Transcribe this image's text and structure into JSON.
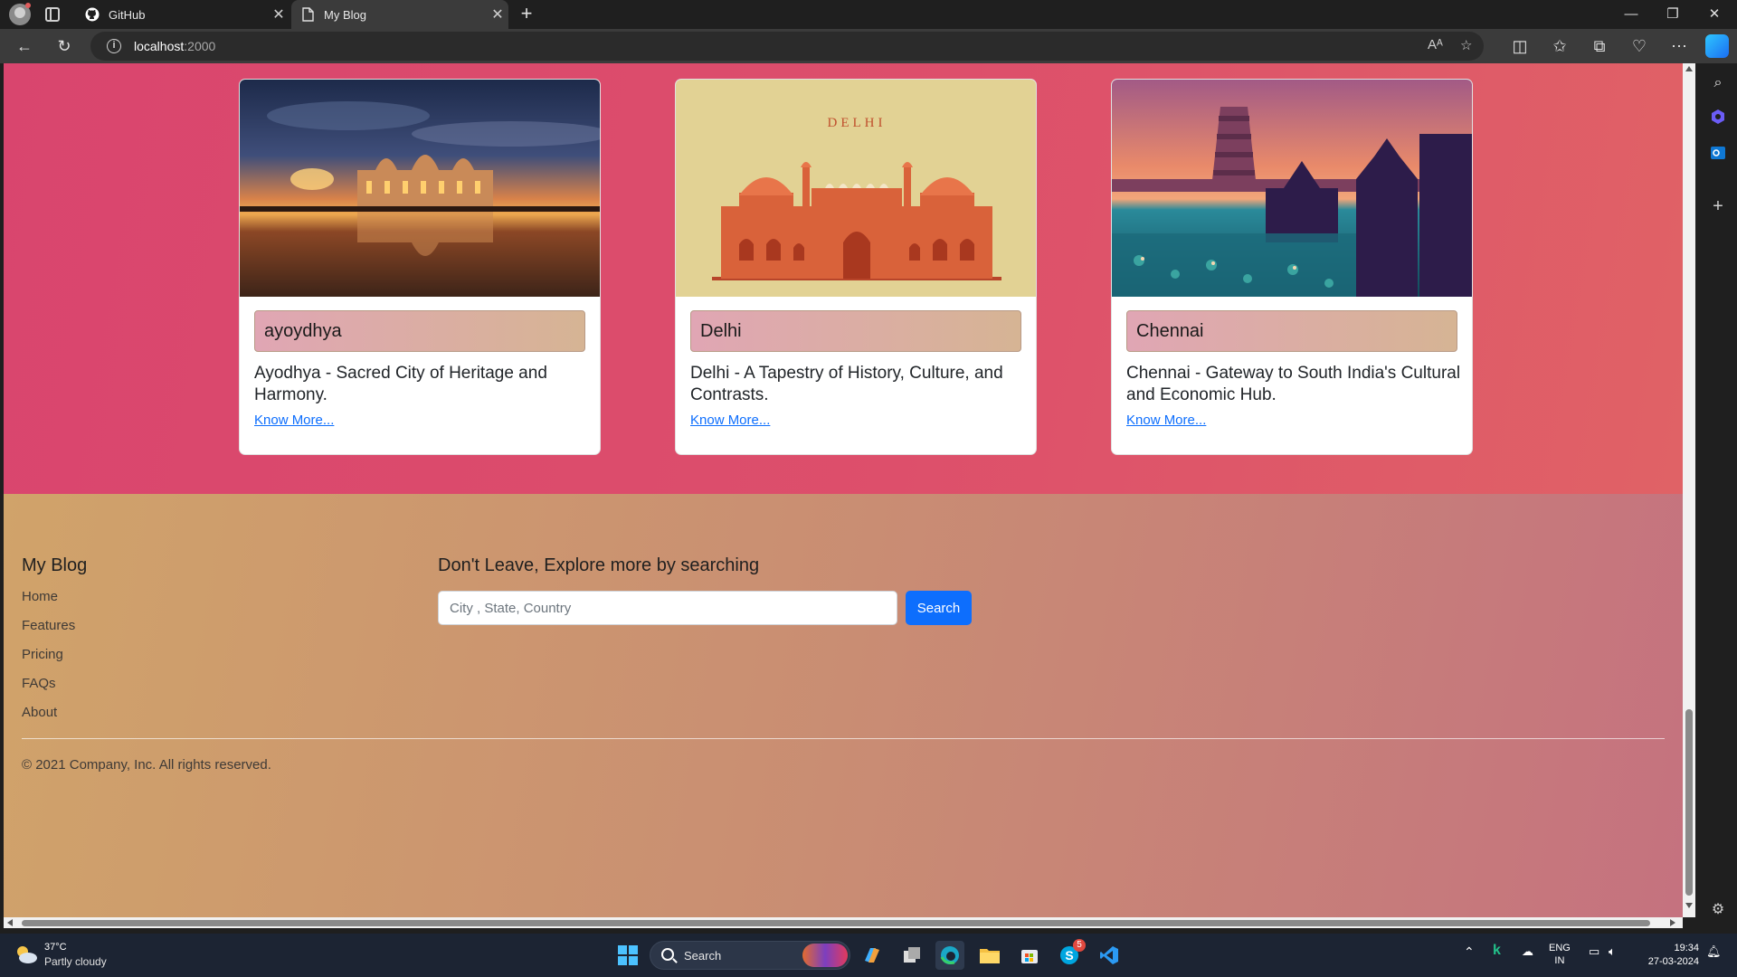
{
  "browser": {
    "tabs": [
      {
        "label": "GitHub",
        "icon": "github-icon",
        "active": false
      },
      {
        "label": "My Blog",
        "icon": "page-icon",
        "active": true
      }
    ],
    "address": {
      "host": "localhost",
      "port": ":2000"
    }
  },
  "cards": [
    {
      "image": "ayodhya-temple-sunset-image",
      "name": "ayoydhya",
      "description": "Ayodhya - Sacred City of Heritage and Harmony.",
      "link": "Know More..."
    },
    {
      "image": "delhi-red-fort-illustration",
      "image_text": "DELHI",
      "name": "Delhi",
      "description": "Delhi - A Tapestry of History, Culture, and Contrasts.",
      "link": "Know More..."
    },
    {
      "image": "chennai-temple-illustration",
      "name": "Chennai",
      "description": "Chennai - Gateway to South India's Cultural and Economic Hub.",
      "link": "Know More..."
    }
  ],
  "footer": {
    "brand": "My Blog",
    "links": [
      "Home",
      "Features",
      "Pricing",
      "FAQs",
      "About"
    ],
    "search_title": "Don't Leave, Explore more by searching",
    "search_placeholder": "City , State, Country",
    "search_value": "",
    "search_button": "Search",
    "copyright": "© 2021 Company, Inc. All rights reserved."
  },
  "colors": {
    "cards_bg": "#d9456e",
    "footer_bg_start": "#d0a36a",
    "footer_bg_end": "#c5727f",
    "link": "#0d6efd",
    "button": "#0d6efd"
  },
  "taskbar": {
    "weather_temp": "37°C",
    "weather_desc": "Partly cloudy",
    "search_label": "Search",
    "store_badge": "5",
    "lang_top": "ENG",
    "lang_bottom": "IN",
    "time": "19:34",
    "date": "27-03-2024"
  }
}
